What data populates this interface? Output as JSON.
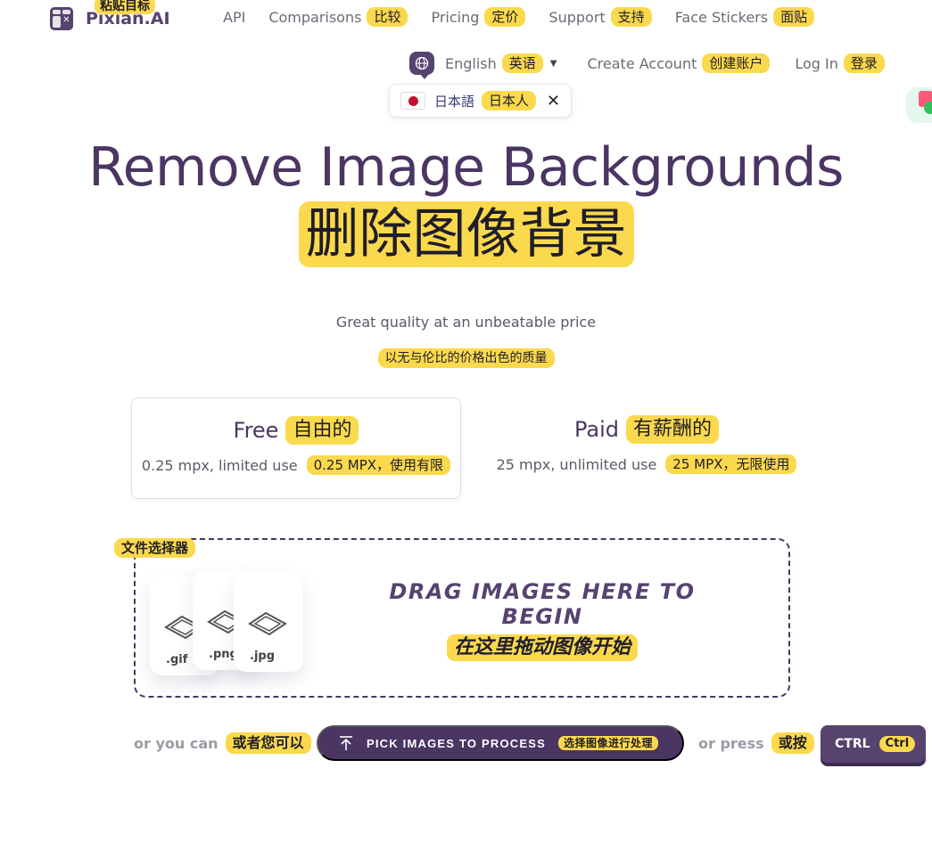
{
  "header": {
    "logo_text": "Pixian.AI",
    "logo_tag": "粘贴目标",
    "nav": [
      {
        "label": "API",
        "tag": ""
      },
      {
        "label": "Comparisons",
        "tag": "比较"
      },
      {
        "label": "Pricing",
        "tag": "定价"
      },
      {
        "label": "Support",
        "tag": "支持"
      },
      {
        "label": "Face Stickers",
        "tag": "面贴"
      }
    ],
    "language": {
      "label": "English",
      "tag": "英语"
    },
    "create_account": {
      "label": "Create Account",
      "tag": "创建账户"
    },
    "login": {
      "label": "Log In",
      "tag": "登录"
    }
  },
  "language_popup": {
    "label": "日本語",
    "tag": "日本人",
    "close": "✕"
  },
  "hero": {
    "title": "Remove Image Backgrounds",
    "title_cn": "删除图像背景",
    "subtitle": "Great quality at an unbeatable price",
    "subtitle_cn": "以无与伦比的价格出色的质量"
  },
  "plans": [
    {
      "name": "Free",
      "name_cn": "自由的",
      "desc": "0.25 mpx, limited use",
      "desc_cn": "0.25 MPX，使用有限"
    },
    {
      "name": "Paid",
      "name_cn": "有薪酬的",
      "desc": "25 mpx, unlimited use",
      "desc_cn": "25 MPX，无限使用"
    }
  ],
  "dropzone": {
    "tag": "文件选择器",
    "title": "DRAG IMAGES HERE TO BEGIN",
    "title_cn": "在这里拖动图像开始",
    "file_types": [
      ".gif",
      ".png",
      ".jpg"
    ]
  },
  "actions": {
    "or_can": "or you can",
    "or_can_cn": "或者您可以",
    "pick_label": "PICK IMAGES TO PROCESS",
    "pick_cn": "选择图像进行处理",
    "or_press": "or press",
    "or_press_cn": "或按",
    "ctrl_label": "CTRL",
    "ctrl_cn": "Ctrl"
  },
  "colors": {
    "brand": "#4a3563",
    "highlight": "#fbd94c",
    "text_muted": "#6b6b76"
  }
}
